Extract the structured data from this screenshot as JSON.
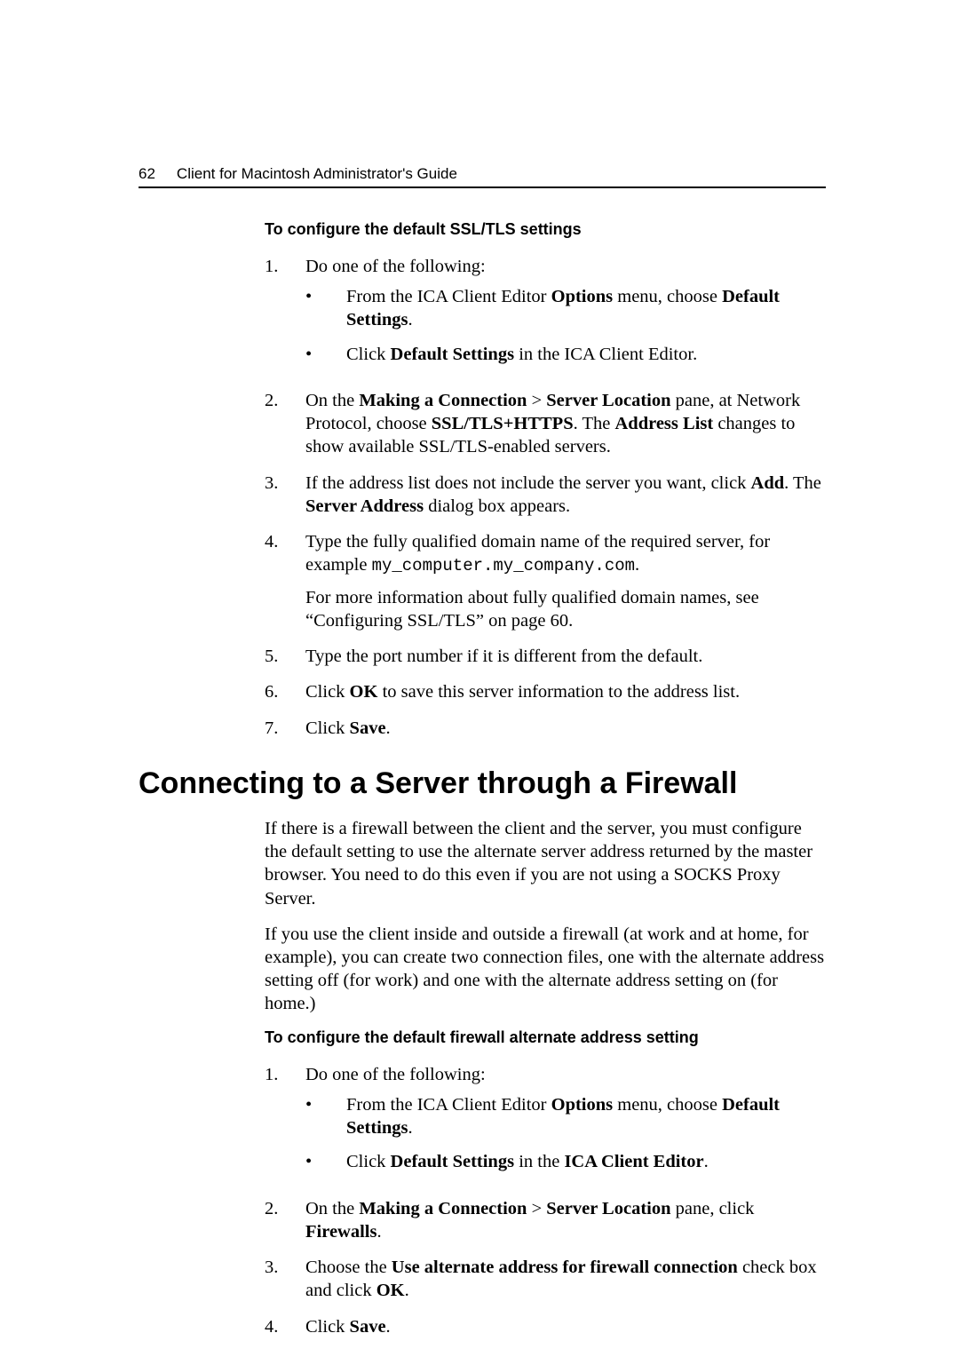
{
  "header": {
    "page_number": "62",
    "title": "Client for Macintosh Administrator's Guide"
  },
  "section1": {
    "subheading": "To configure the default SSL/TLS settings",
    "item1_num": "1.",
    "item1_text": "Do one of the following:",
    "item1_bullet1_pre": "From the ICA Client Editor ",
    "item1_bullet1_b1": "Options",
    "item1_bullet1_mid": " menu, choose ",
    "item1_bullet1_b2": "Default Settings",
    "item1_bullet1_post": ".",
    "item1_bullet2_pre": "Click ",
    "item1_bullet2_b1": "Default Settings",
    "item1_bullet2_post": " in the ICA Client Editor.",
    "item2_num": "2.",
    "item2_pre": "On the ",
    "item2_b1": "Making a Connection",
    "item2_gt": " > ",
    "item2_b2": "Server Location",
    "item2_mid1": " pane, at Network Protocol, choose ",
    "item2_b3": "SSL/TLS+HTTPS",
    "item2_mid2": ". The ",
    "item2_b4": "Address List",
    "item2_post": " changes to show available SSL/TLS-enabled servers.",
    "item3_num": "3.",
    "item3_pre": "If the address list does not include the server you want, click ",
    "item3_b1": "Add",
    "item3_mid": ". The ",
    "item3_b2": "Server Address",
    "item3_post": " dialog box appears.",
    "item4_num": "4.",
    "item4_text": "Type the fully qualified domain name of the required server, for example ",
    "item4_code": "my_computer.my_company.com",
    "item4_post": ".",
    "item4_para2": "For more information about fully qualified domain names, see “Configuring SSL/TLS” on page 60.",
    "item5_num": "5.",
    "item5_text": "Type the port number if it is different from the default.",
    "item6_num": "6.",
    "item6_pre": "Click ",
    "item6_b1": "OK",
    "item6_post": " to save this server information to the address list.",
    "item7_num": "7.",
    "item7_pre": "Click ",
    "item7_b1": "Save",
    "item7_post": "."
  },
  "section2": {
    "h1": "Connecting to a Server through a Firewall",
    "para1": "If there is a firewall between the client and the server, you must configure the default setting to use the alternate server address returned by the master browser. You need to do this even if you are not using a SOCKS Proxy Server.",
    "para2": "If you use the client inside and outside a firewall (at work and at home, for example), you can create two connection files, one with the alternate address setting off (for work) and one with the alternate address setting on (for home.)",
    "subheading": "To configure the default firewall alternate address setting",
    "item1_num": "1.",
    "item1_text": "Do one of the following:",
    "item1_bullet1_pre": "From the ICA Client Editor ",
    "item1_bullet1_b1": "Options",
    "item1_bullet1_mid": " menu, choose ",
    "item1_bullet1_b2": "Default Settings",
    "item1_bullet1_post": ".",
    "item1_bullet2_pre": "Click ",
    "item1_bullet2_b1": "Default Settings",
    "item1_bullet2_mid": " in the ",
    "item1_bullet2_b2": "ICA Client Editor",
    "item1_bullet2_post": ".",
    "item2_num": "2.",
    "item2_pre": "On the ",
    "item2_b1": "Making a Connection",
    "item2_gt": " > ",
    "item2_b2": "Server Location",
    "item2_mid": " pane, click ",
    "item2_b3": "Firewalls",
    "item2_post": ".",
    "item3_num": "3.",
    "item3_pre": "Choose the ",
    "item3_b1": "Use alternate address for firewall connection",
    "item3_mid": " check box and click ",
    "item3_b2": "OK",
    "item3_post": ".",
    "item4_num": "4.",
    "item4_pre": "Click ",
    "item4_b1": "Save",
    "item4_post": "."
  }
}
